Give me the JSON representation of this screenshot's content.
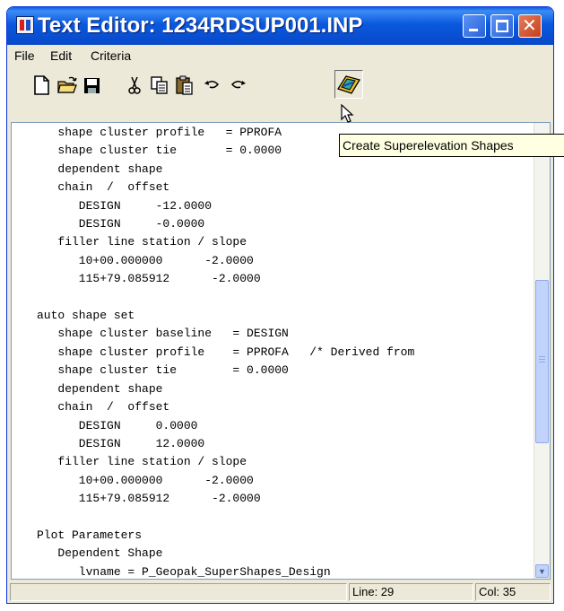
{
  "window": {
    "title": "Text Editor: 1234RDSUP001.INP"
  },
  "menu": [
    {
      "label": "File"
    },
    {
      "label": "Edit"
    },
    {
      "label": "Criteria"
    }
  ],
  "toolbar": {
    "buttons": [
      {
        "name": "new-file-icon"
      },
      {
        "name": "open-folder-icon"
      },
      {
        "name": "save-icon"
      },
      {
        "name": "cut-icon"
      },
      {
        "name": "copy-icon"
      },
      {
        "name": "paste-icon"
      },
      {
        "name": "undo-icon"
      },
      {
        "name": "redo-icon"
      },
      {
        "name": "create-superelevation-shapes-icon"
      }
    ],
    "tooltip": "Create Superelevation Shapes"
  },
  "editor": {
    "lines": [
      "   shape cluster profile   = PPROFA",
      "   shape cluster tie       = 0.0000",
      "   dependent shape",
      "   chain  /  offset",
      "      DESIGN     -12.0000",
      "      DESIGN     -0.0000",
      "   filler line station / slope",
      "      10+00.000000      -2.0000",
      "      115+79.085912      -2.0000",
      "",
      "auto shape set",
      "   shape cluster baseline   = DESIGN",
      "   shape cluster profile    = PPROFA   /* Derived from",
      "   shape cluster tie        = 0.0000",
      "   dependent shape",
      "   chain  /  offset",
      "      DESIGN     0.0000",
      "      DESIGN     12.0000",
      "   filler line station / slope",
      "      10+00.000000      -2.0000",
      "      115+79.085912      -2.0000",
      "",
      "Plot Parameters",
      "   Dependent Shape",
      "      lvname = P_Geopak_SuperShapes_Design"
    ]
  },
  "status": {
    "message": "",
    "line": "Line: 29",
    "col": "Col: 35"
  },
  "colors": {
    "titlebar": "#0a58de",
    "close_button": "#c6401c",
    "tooltip_bg": "#ffffe1",
    "window_bg": "#ece9d8"
  }
}
